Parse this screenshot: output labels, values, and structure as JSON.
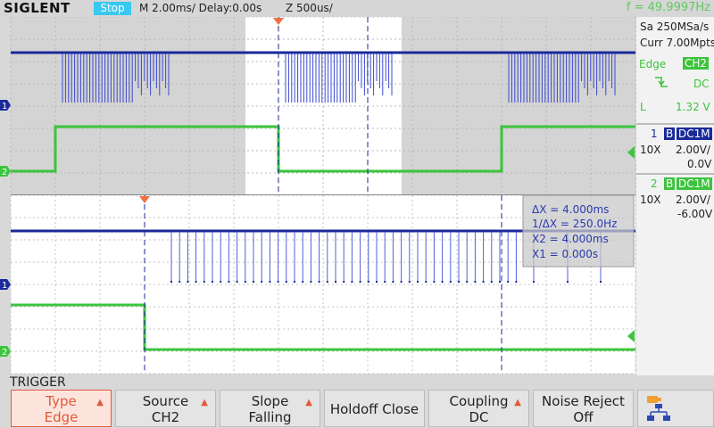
{
  "header": {
    "brand": "SIGLENT",
    "status": "Stop",
    "timebase": "M 2.00ms/ Delay:0.00s",
    "zoom": "Z 500us/",
    "frequency": "f = 49.9997Hz"
  },
  "acquisition": {
    "sample_rate": "Sa 250MSa/s",
    "memory": "Curr 7.00Mpts"
  },
  "trigger_info": {
    "type": "Edge",
    "source_badge": "CH2",
    "slope_icon": "falling-edge-icon",
    "coupling": "DC",
    "level_label": "L",
    "level": "1.32 V"
  },
  "channels": [
    {
      "number": "1",
      "bw": "B",
      "coupling": "DC1M",
      "probe": "10X",
      "scale": "2.00V/",
      "offset": "0.0V",
      "color": "#1a2a9a"
    },
    {
      "number": "2",
      "bw": "B",
      "coupling": "DC1M",
      "probe": "10X",
      "scale": "2.00V/",
      "offset": "-6.00V",
      "color": "#3cc43c"
    }
  ],
  "cursor_readout": {
    "dx": "ΔX = 4.000ms",
    "inv_dx": "1/ΔX = 250.0Hz",
    "x2": "X2 = 4.000ms",
    "x1": "X1 = 0.000s"
  },
  "markers": {
    "ch1": "1",
    "ch2": "2"
  },
  "menu": {
    "title": "TRIGGER",
    "softkeys": [
      {
        "line1": "Type",
        "line2": "Edge",
        "active": true,
        "arrow": true
      },
      {
        "line1": "Source",
        "line2": "CH2",
        "active": false,
        "arrow": true
      },
      {
        "line1": "Slope",
        "line2": "Falling",
        "active": false,
        "arrow": true
      },
      {
        "line1": "Holdoff Close",
        "line2": "",
        "active": false,
        "arrow": false
      },
      {
        "line1": "Coupling",
        "line2": "DC",
        "active": false,
        "arrow": true
      },
      {
        "line1": "Noise Reject",
        "line2": "Off",
        "active": false,
        "arrow": false
      }
    ],
    "network_icon": "network-icon"
  },
  "colors": {
    "ch1": "#1a2a9a",
    "ch2": "#3cc43c",
    "accent": "#e05a3a",
    "status_bg": "#38c8f0"
  }
}
